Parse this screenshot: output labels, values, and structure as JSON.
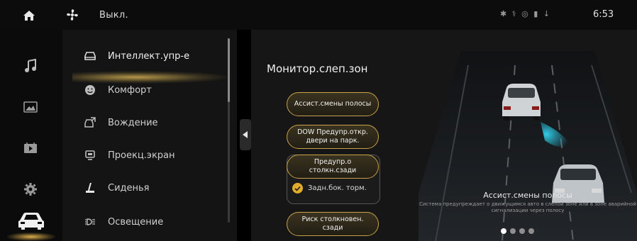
{
  "statusbar": {
    "home_icon": "home-icon",
    "fan_icon": "fan-icon",
    "fan_label": "Выкл.",
    "status_icons": "✱ ⚕ ◎ ▮ ↓",
    "time": "6:53"
  },
  "rail": {
    "items": [
      {
        "icon": "music-icon"
      },
      {
        "icon": "gallery-icon"
      },
      {
        "icon": "video-icon"
      },
      {
        "icon": "settings-icon"
      },
      {
        "icon": "car-icon",
        "active": true
      }
    ]
  },
  "menu": {
    "items": [
      {
        "label": "Интеллект.упр-е",
        "icon": "intelligent-drive-icon",
        "selected": true
      },
      {
        "label": "Комфорт",
        "icon": "comfort-icon"
      },
      {
        "label": "Вождение",
        "icon": "driving-icon"
      },
      {
        "label": "Проекц.экран",
        "icon": "projection-screen-icon"
      },
      {
        "label": "Сиденья",
        "icon": "seat-icon"
      },
      {
        "label": "Освещение",
        "icon": "lighting-icon"
      }
    ]
  },
  "content": {
    "title": "Монитор.слеп.зон",
    "buttons": {
      "lane_assist": "Ассист.смены полосы",
      "dow": "DOW Предупр.откр. двери на парк.",
      "rear_collision": "Предупр.о столкн.сзади",
      "collision_risk": "Риск столкновен. сзади"
    },
    "checkbox": {
      "label": "Задн.бок. торм.",
      "checked": true
    },
    "info": {
      "title": "Ассист.смены полосы",
      "description": "Система предупреждает о движущимся авто в слепой зоне или в зоне аварийной сигнализации через полосу"
    },
    "pagination": {
      "total": 4,
      "current": 1
    }
  },
  "colors": {
    "accent": "#e1ac2d",
    "pill_border": "#c7a24a",
    "panel": "#161616",
    "menu": "#141414",
    "sensor": "#1fb6d6"
  }
}
